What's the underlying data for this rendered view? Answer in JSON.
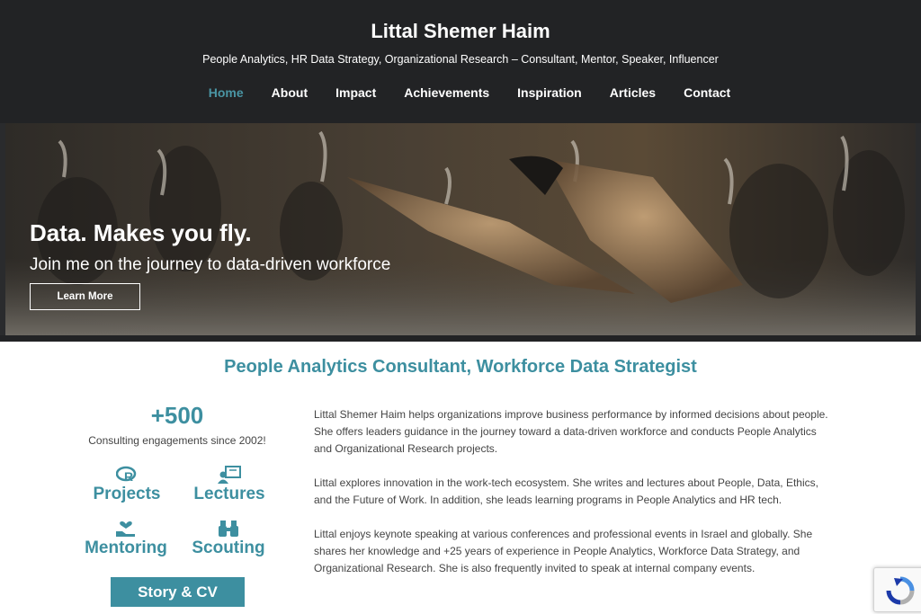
{
  "header": {
    "site_title": "Littal Shemer Haim",
    "tagline": "People Analytics, HR Data Strategy, Organizational Research – Consultant, Mentor, Speaker, Influencer",
    "nav": [
      {
        "label": "Home",
        "active": true
      },
      {
        "label": "About"
      },
      {
        "label": "Impact"
      },
      {
        "label": "Achievements"
      },
      {
        "label": "Inspiration"
      },
      {
        "label": "Articles"
      },
      {
        "label": "Contact"
      }
    ]
  },
  "hero": {
    "title": "Data. Makes you fly.",
    "subtitle": "Join me on the journey to data-driven workforce",
    "button_label": "Learn More"
  },
  "main": {
    "section_title": "People Analytics Consultant, Workforce Data Strategist",
    "stat": {
      "number": "+500",
      "caption": "Consulting engagements since 2002!"
    },
    "services": [
      {
        "label": "Projects",
        "icon": "r-logo-icon"
      },
      {
        "label": "Lectures",
        "icon": "presenter-icon"
      },
      {
        "label": "Mentoring",
        "icon": "heart-hand-icon"
      },
      {
        "label": "Scouting",
        "icon": "binoculars-icon"
      }
    ],
    "cta_label": "Story & CV",
    "bio": [
      "Littal Shemer Haim helps organizations improve business performance by informed decisions about people. She offers leaders guidance in the journey toward a data-driven workforce and conducts People Analytics and Organizational Research projects.",
      "Littal explores innovation in the work-tech ecosystem. She writes and lectures about People, Data, Ethics, and the Future of Work. In addition, she leads learning programs in People Analytics and HR tech.",
      "Littal enjoys keynote speaking at various conferences and professional events in Israel and globally. She shares her knowledge and +25 years of experience in People Analytics, Workforce Data Strategy, and Organizational Research. She is also frequently invited to speak at internal company events."
    ]
  },
  "colors": {
    "accent": "#3d8fa0",
    "nav_active": "#4a95a4",
    "header_bg": "#222325"
  }
}
